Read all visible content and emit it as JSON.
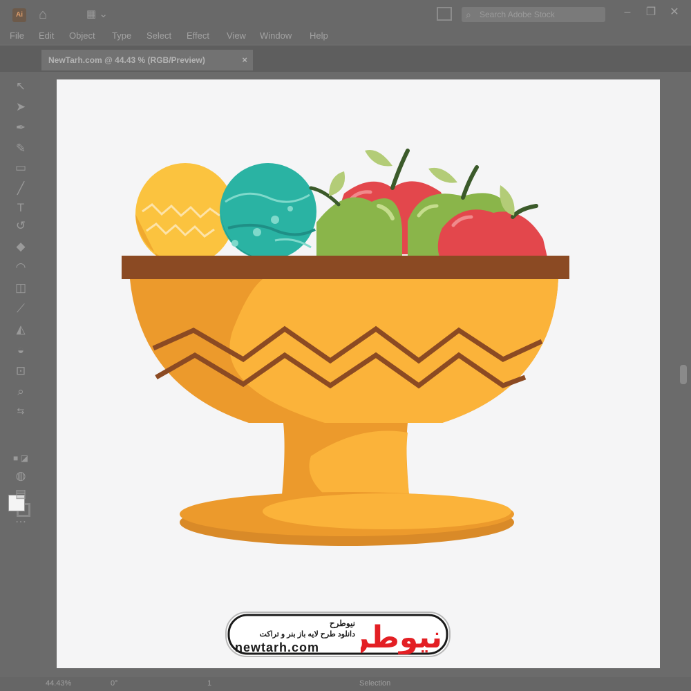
{
  "app": {
    "icon_text": "Ai",
    "workspace_icon": "workspace-switcher-icon",
    "search_placeholder": "Search Adobe Stock"
  },
  "menu": [
    "File",
    "Edit",
    "Object",
    "Type",
    "Select",
    "Effect",
    "View",
    "Window",
    "Help"
  ],
  "document_tab": {
    "title": "NewTarh.com @ 44.43 % (RGB/Preview)",
    "close": "×"
  },
  "tools": [
    "selection-tool-icon",
    "direct-selection-tool-icon",
    "pen-tool-icon",
    "curvature-tool-icon",
    "rectangle-tool-icon",
    "paintbrush-tool-icon",
    "type-tool-icon",
    "rotate-tool-icon",
    "eraser-tool-icon",
    "warp-tool-icon",
    "free-transform-tool-icon",
    "eyedropper-tool-icon",
    "shape-builder-tool-icon",
    "blend-tool-icon",
    "artboard-tool-icon",
    "zoom-tool-icon"
  ],
  "status": {
    "zoom": "44.43%",
    "rotation": "0°",
    "artboard_number": "1",
    "mode": "Selection"
  },
  "watermark": {
    "brand_persian": "نیوطرح",
    "tagline_persian": "دانلود طرح لایه باز بنر و تراکت",
    "url": "newtarh.com",
    "logo_persian": "نیوطرح"
  },
  "colors": {
    "bowl_light": "#fbb33a",
    "bowl_shade": "#ec9a2c",
    "rim": "#8b4a23",
    "egg_yellow": "#fbc33f",
    "egg_teal": "#2aa398",
    "apple_red": "#e3474c",
    "apple_green": "#8ab54a",
    "logo_red": "#e31f24"
  }
}
